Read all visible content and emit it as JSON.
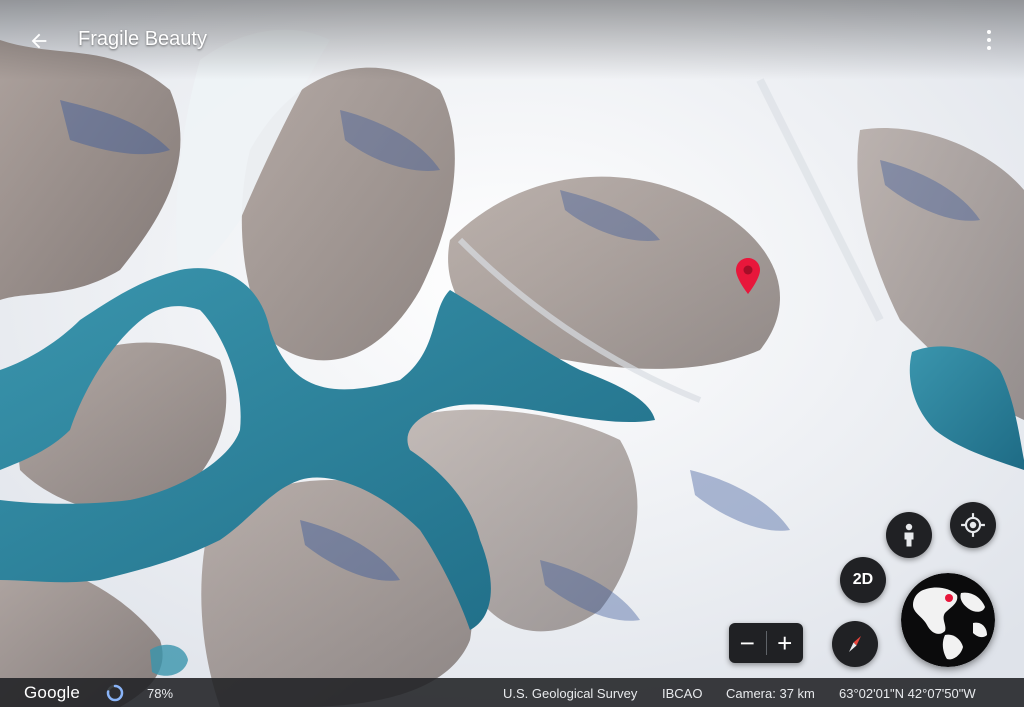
{
  "header": {
    "title": "Fragile Beauty",
    "back_icon": "arrow-back-icon",
    "menu_icon": "more-vert-icon"
  },
  "map": {
    "placemark_color": "#e8173b",
    "water_color": "#2b7e98",
    "snow_color": "#f2f4f7",
    "rock_color": "#7d6f68"
  },
  "controls": {
    "dimension_label": "2D",
    "zoom_out_label": "−",
    "zoom_in_label": "+",
    "pegman_icon": "person-icon",
    "locate_icon": "my-location-icon",
    "compass_icon": "compass-icon"
  },
  "status_bar": {
    "logo": "Google",
    "load_percent": "78%",
    "load_progress": 0.78,
    "attribution_1": "U.S. Geological Survey",
    "attribution_2": "IBCAO",
    "camera": "Camera: 37 km",
    "coordinates": "63°02'01\"N 42°07'50\"W"
  }
}
